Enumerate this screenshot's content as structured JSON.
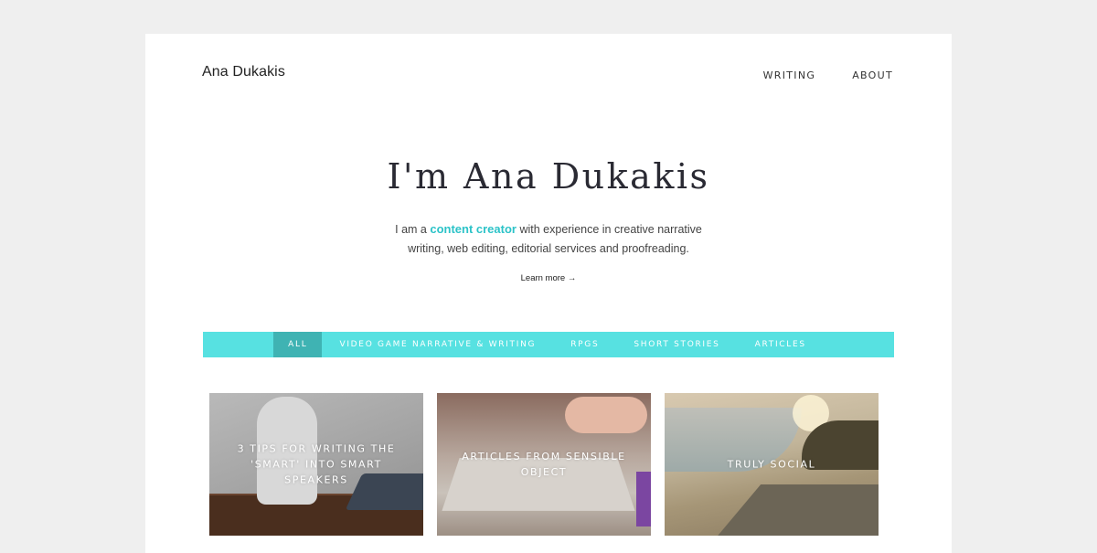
{
  "site": {
    "title": "Ana Dukakis"
  },
  "nav": {
    "items": [
      "WRITING",
      "ABOUT"
    ]
  },
  "hero": {
    "title": "I'm Ana Dukakis",
    "intro_before": "I am a ",
    "intro_accent": "content creator",
    "intro_after_line1": " with experience in creative narrative",
    "intro_line2": "writing, web editing, editorial services and proofreading.",
    "learn_more": "Learn more →",
    "accent_color": "#2cc3c8"
  },
  "filters": {
    "bar_color": "#57e1e1",
    "active_color": "#3fb3b3",
    "tabs": [
      {
        "label": "ALL",
        "active": true
      },
      {
        "label": "VIDEO GAME NARRATIVE & WRITING",
        "active": false
      },
      {
        "label": "RPGS",
        "active": false
      },
      {
        "label": "SHORT STORIES",
        "active": false
      },
      {
        "label": "ARTICLES",
        "active": false
      }
    ]
  },
  "cards": [
    {
      "caption": "3 TIPS FOR WRITING THE 'SMART' INTO SMART SPEAKERS"
    },
    {
      "caption": "ARTICLES FROM SENSIBLE OBJECT"
    },
    {
      "caption": "TRULY SOCIAL"
    }
  ]
}
